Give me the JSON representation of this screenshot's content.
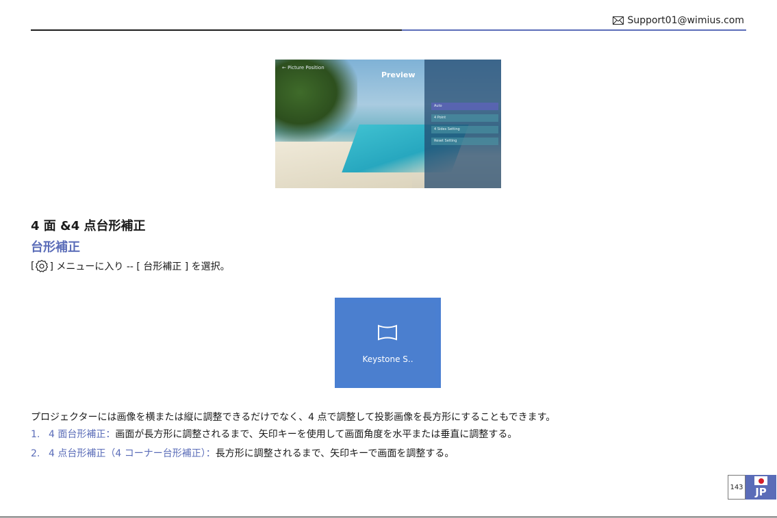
{
  "header": {
    "email": "Support01@wimius.com"
  },
  "preview": {
    "title": "Preview",
    "back_label": "← Picture Position",
    "menu_items": [
      "Auto",
      "4 Point",
      "4 Sides Setting",
      "Reset Setting"
    ]
  },
  "section": {
    "heading": "4 面 &4 点台形補正",
    "subheading": "台形補正",
    "instruction_open": "[",
    "instruction_rest": "] メニューに入り --  [ 台形補正 ] を選択。"
  },
  "tile": {
    "label": "Keystone S.."
  },
  "body": {
    "paragraph": "プロジェクターには画像を横または縦に調整できるだけでなく、4 点で調整して投影画像を長方形にすることもできます。",
    "items": [
      {
        "num": "1.",
        "term": "4 面台形補正：",
        "desc": "画面が長方形に調整されるまで、矢印キーを使用して画面角度を水平または垂直に調整する。"
      },
      {
        "num": "2.",
        "term": "4 点台形補正（4 コーナー台形補正）：",
        "desc": "長方形に調整されるまで、矢印キーで画面を調整する。"
      }
    ]
  },
  "footer": {
    "page_number": "143",
    "language": "JP"
  },
  "colors": {
    "accent": "#5a6cb8",
    "tile": "#4a7fd1",
    "flag_red": "#d31f2b"
  }
}
